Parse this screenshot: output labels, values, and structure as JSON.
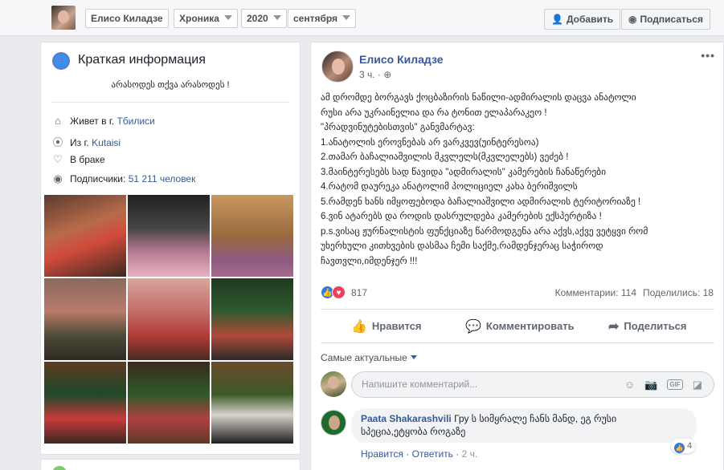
{
  "topbar": {
    "name": "Елисо Киладзе",
    "filter": "Хроника",
    "year": "2020",
    "month": "сентября",
    "add_label": "Добавить",
    "subscribe_label": "Подписаться"
  },
  "intro": {
    "title": "Краткая информация",
    "bio": "არასოდეს თქვა არასოდეს !",
    "lives_prefix": "Живет в г.",
    "lives_city": "Тбилиси",
    "from_prefix": "Из г.",
    "from_city": "Kutaisi",
    "relationship": "В браке",
    "followers_prefix": "Подписчики:",
    "followers_count": "51 211 человек"
  },
  "post": {
    "author": "Елисо Киладзе",
    "time": "3 ч.",
    "lines": [
      "ამ დრომდე ბორგავს ქოცბაზირის ნაწილი-ადმირალის დაცვა ანატოლი",
      "რუსი არა უკრაინელია და რა ტონით ელაპარაკეო !",
      "\"პრადვინუტებისთვის\" განვმარტავ:",
      "1.ანატოლის ეროვნებას არ ვარკვევ(უინტერესოა)",
      "2.თამარ ბაჩალიაშვილის მკვლელს(მკვლელებს) ვეძებ !",
      "3.მაინტერესებს სად წავიდა \"ადმირალის\" კამერების ჩანაწერები",
      "4.რატომ დაურეკა ანატოლიმ პოლიციელ კახა ბერიშვილს",
      "5.რამდენ ხანს იმყოფებოდა ბაჩალიაშვილი ადმირალის ტერიტორიაზე !",
      "6.ვინ ატარებს და როდის დასრულდება კამერების ექსპერტიზა !",
      "p.s.ვისაც ჟურნალისტის ფუნქციაზე წარმოდგენა არა აქვს,აქვე ვეტყვი რომ",
      "უხერხული კითხვების დასმაა ჩემი საქმე,რამდენჯერაც საჭიროდ",
      "ჩავთვლი,იმდენჯერ !!!"
    ],
    "reactions_count": "817",
    "comments_count": "Комментарии: 114",
    "shares_count": "Поделились: 18",
    "like_label": "Нравится",
    "comment_label": "Комментировать",
    "share_label": "Поделиться",
    "sort_label": "Самые актуальные",
    "comment_placeholder": "Напишите комментарий..."
  },
  "comment": {
    "author": "Paata Shakarashvili",
    "text_line1": "Гру ს სიმყრალე ჩანს მანდ, ეგ რუსი",
    "text_line2": "სპეცია,ეტყობა როგაზე",
    "likes": "4",
    "like_action": "Нравится",
    "reply_action": "Ответить",
    "time": "2 ч."
  },
  "colors": {
    "link": "#385898",
    "like_blue": "#3578e5",
    "love_red": "#f33e58"
  }
}
